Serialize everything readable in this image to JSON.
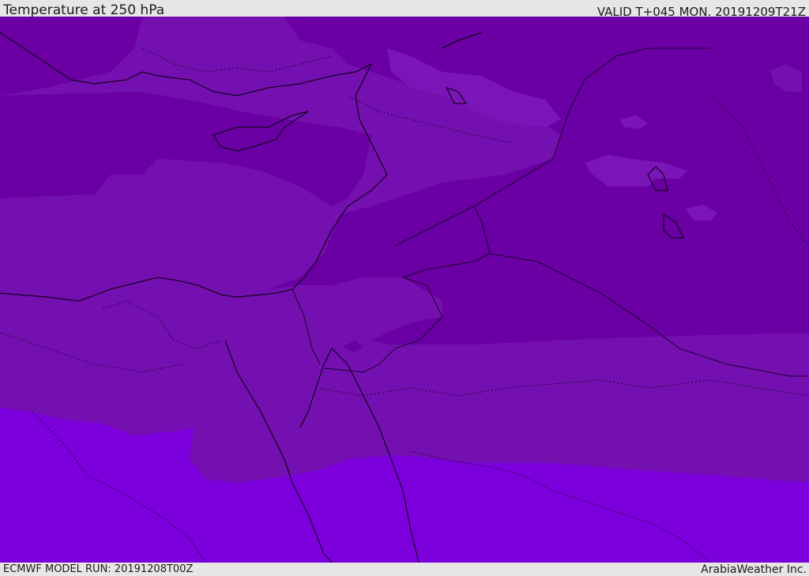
{
  "header": {
    "title": "Temperature at 250 hPa",
    "valid": "VALID T+045 MON. 20191209T21Z"
  },
  "footer": {
    "model_run": "ECMWF MODEL RUN: 20191208T00Z",
    "credit": "ArabiaWeather Inc."
  },
  "map": {
    "variable": "temperature",
    "level": "250 hPa",
    "colors": {
      "band_coldest": "#6a00a3",
      "band_cold": "#7410b0",
      "band_mid": "#7a16b8",
      "band_light": "#861cc4",
      "band_warm": "#7b00dc",
      "coast": "#000000",
      "borders": "#1a0030"
    }
  }
}
